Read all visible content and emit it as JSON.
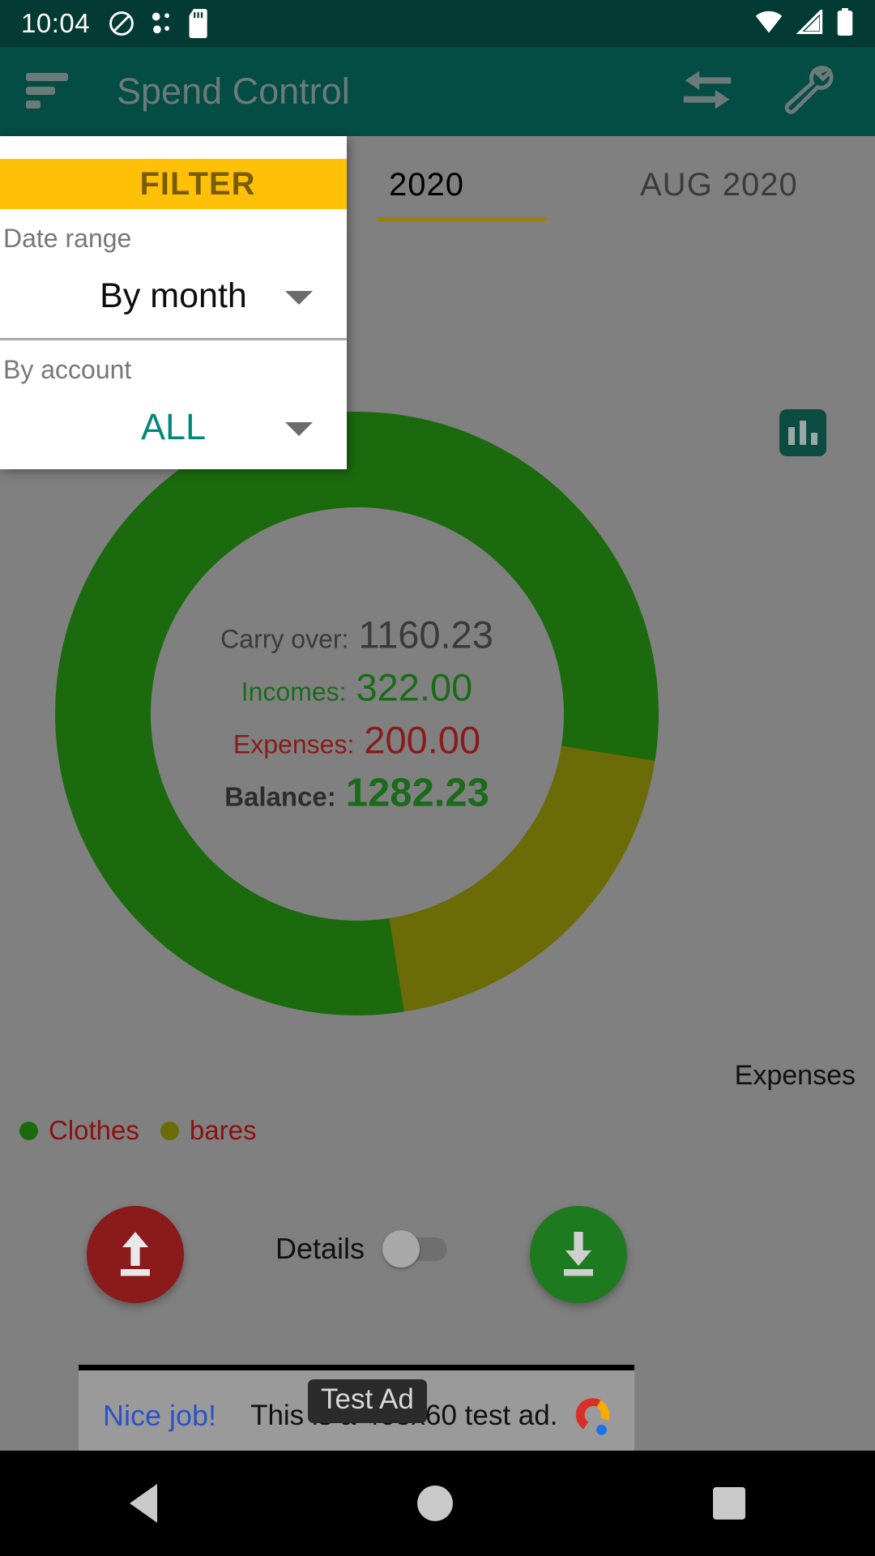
{
  "status_bar": {
    "clock": "10:04",
    "icons": [
      "do-not-disturb-icon",
      "bluetooth-dots-icon",
      "sd-card-icon"
    ],
    "right_icons": [
      "wifi-icon",
      "cellular-signal-icon",
      "battery-icon"
    ]
  },
  "app_bar": {
    "title": "Spend Control",
    "menu_icon": "sort-menu-icon",
    "transfer_icon": "transfer-arrows-icon",
    "settings_icon": "wrench-icon"
  },
  "tabs": {
    "previous": "2020",
    "selected": "2020",
    "next": "AUG  2020",
    "chart_type_icon": "bar-chart-icon"
  },
  "summary": {
    "carry_over_label": "Carry over:",
    "carry_over_value": "1160.23",
    "incomes_label": "Incomes:",
    "incomes_value": "322.00",
    "expenses_label": "Expenses:",
    "expenses_value": "200.00",
    "balance_label": "Balance:",
    "balance_value": "1282.23"
  },
  "chart_caption": "Expenses",
  "legend": [
    {
      "label": "Clothes",
      "color": "#1b6b0e"
    },
    {
      "label": "bares",
      "color": "#6b6b07"
    }
  ],
  "bottom": {
    "income_fab_icon": "upload-arrow-icon",
    "expense_fab_icon": "download-arrow-icon",
    "details_label": "Details",
    "details_toggle_state": "off"
  },
  "ad": {
    "chip": "Test Ad",
    "cta": "Nice job!",
    "text": "This is a 468x60 test ad.",
    "logo_icon": "google-ads-icon"
  },
  "filter_panel": {
    "title": "FILTER",
    "date_range_label": "Date range",
    "date_range_value": "By month",
    "account_label": "By account",
    "account_value": "ALL",
    "caret_icon": "chevron-down-icon"
  },
  "nav_bar": {
    "back_icon": "back-triangle-icon",
    "home_icon": "home-circle-icon",
    "recents_icon": "recents-square-icon"
  },
  "chart_data": {
    "type": "pie",
    "title": "Expenses",
    "categories": [
      "Clothes",
      "bares"
    ],
    "values": [
      160.0,
      40.0
    ],
    "colors": [
      "#1b6b0e",
      "#6b6b07"
    ],
    "legend_position": "bottom-left",
    "donut": true,
    "total": 200.0
  }
}
